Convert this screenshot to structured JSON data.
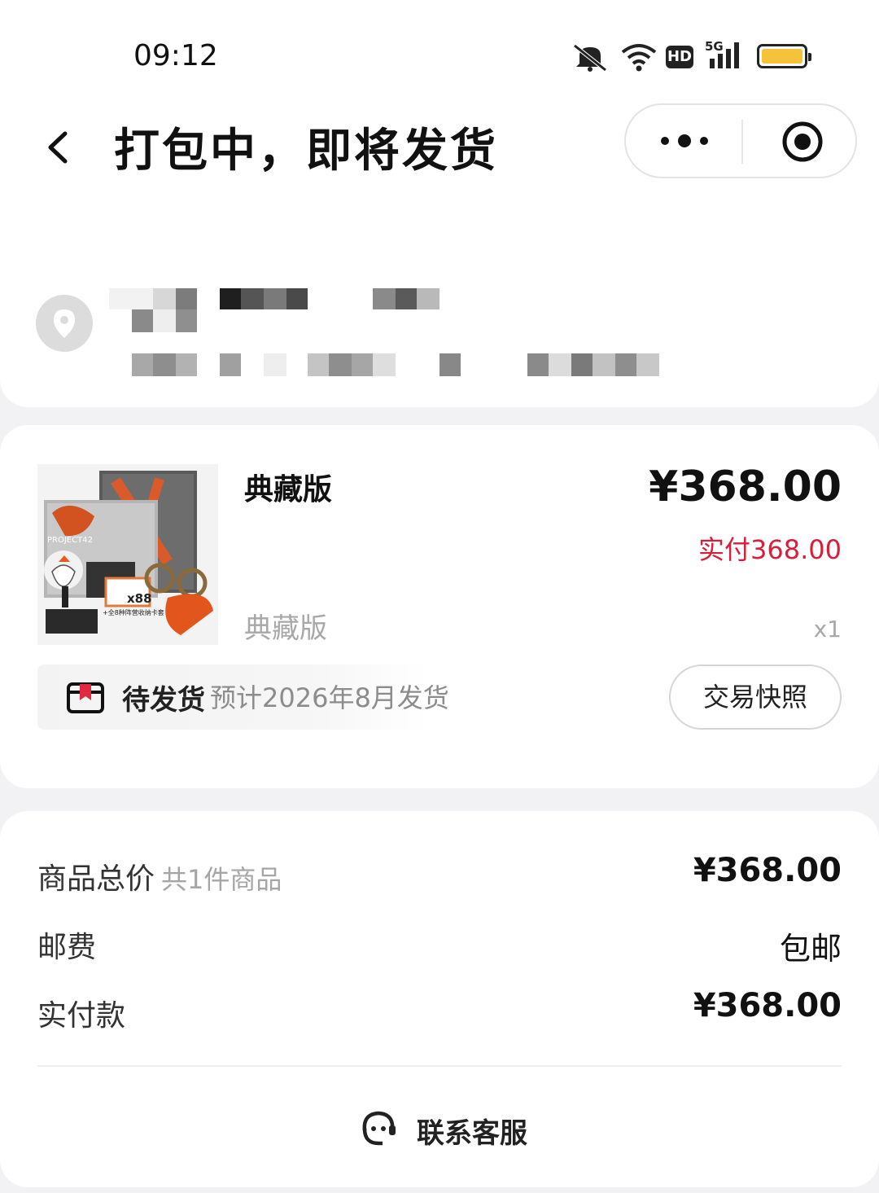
{
  "status_bar": {
    "time": "09:12",
    "icons": [
      "mute-icon",
      "wifi-icon",
      "hd-icon",
      "5g-signal-icon",
      "battery-icon"
    ],
    "hd_label": "HD",
    "network_label": "5G"
  },
  "header": {
    "title": "打包中，即将发货",
    "more_icon": "more-dots-icon",
    "close_icon": "target-close-icon"
  },
  "address": {
    "icon": "location-pin-icon",
    "name": "",
    "detail": ""
  },
  "product": {
    "name": "典藏版",
    "price": "¥368.00",
    "paid": "实付368.00",
    "spec": "典藏版",
    "quantity": "x1",
    "thumbnail_text": "PROJECT42",
    "thumbnail_badge": "x88",
    "thumbnail_caption": "+全8种阵营收纳卡套",
    "accent_color": "#d81e3a"
  },
  "shipping": {
    "label": "待发货",
    "eta": "预计2026年8月发货",
    "snapshot_button": "交易快照"
  },
  "summary": {
    "goods_total_label": "商品总价",
    "goods_count": "共1件商品",
    "goods_total_value": "¥368.00",
    "postage_label": "邮费",
    "postage_value": "包邮",
    "paid_label": "实付款",
    "paid_value": "¥368.00"
  },
  "contact": {
    "label": "联系客服",
    "icon": "customer-service-icon"
  }
}
